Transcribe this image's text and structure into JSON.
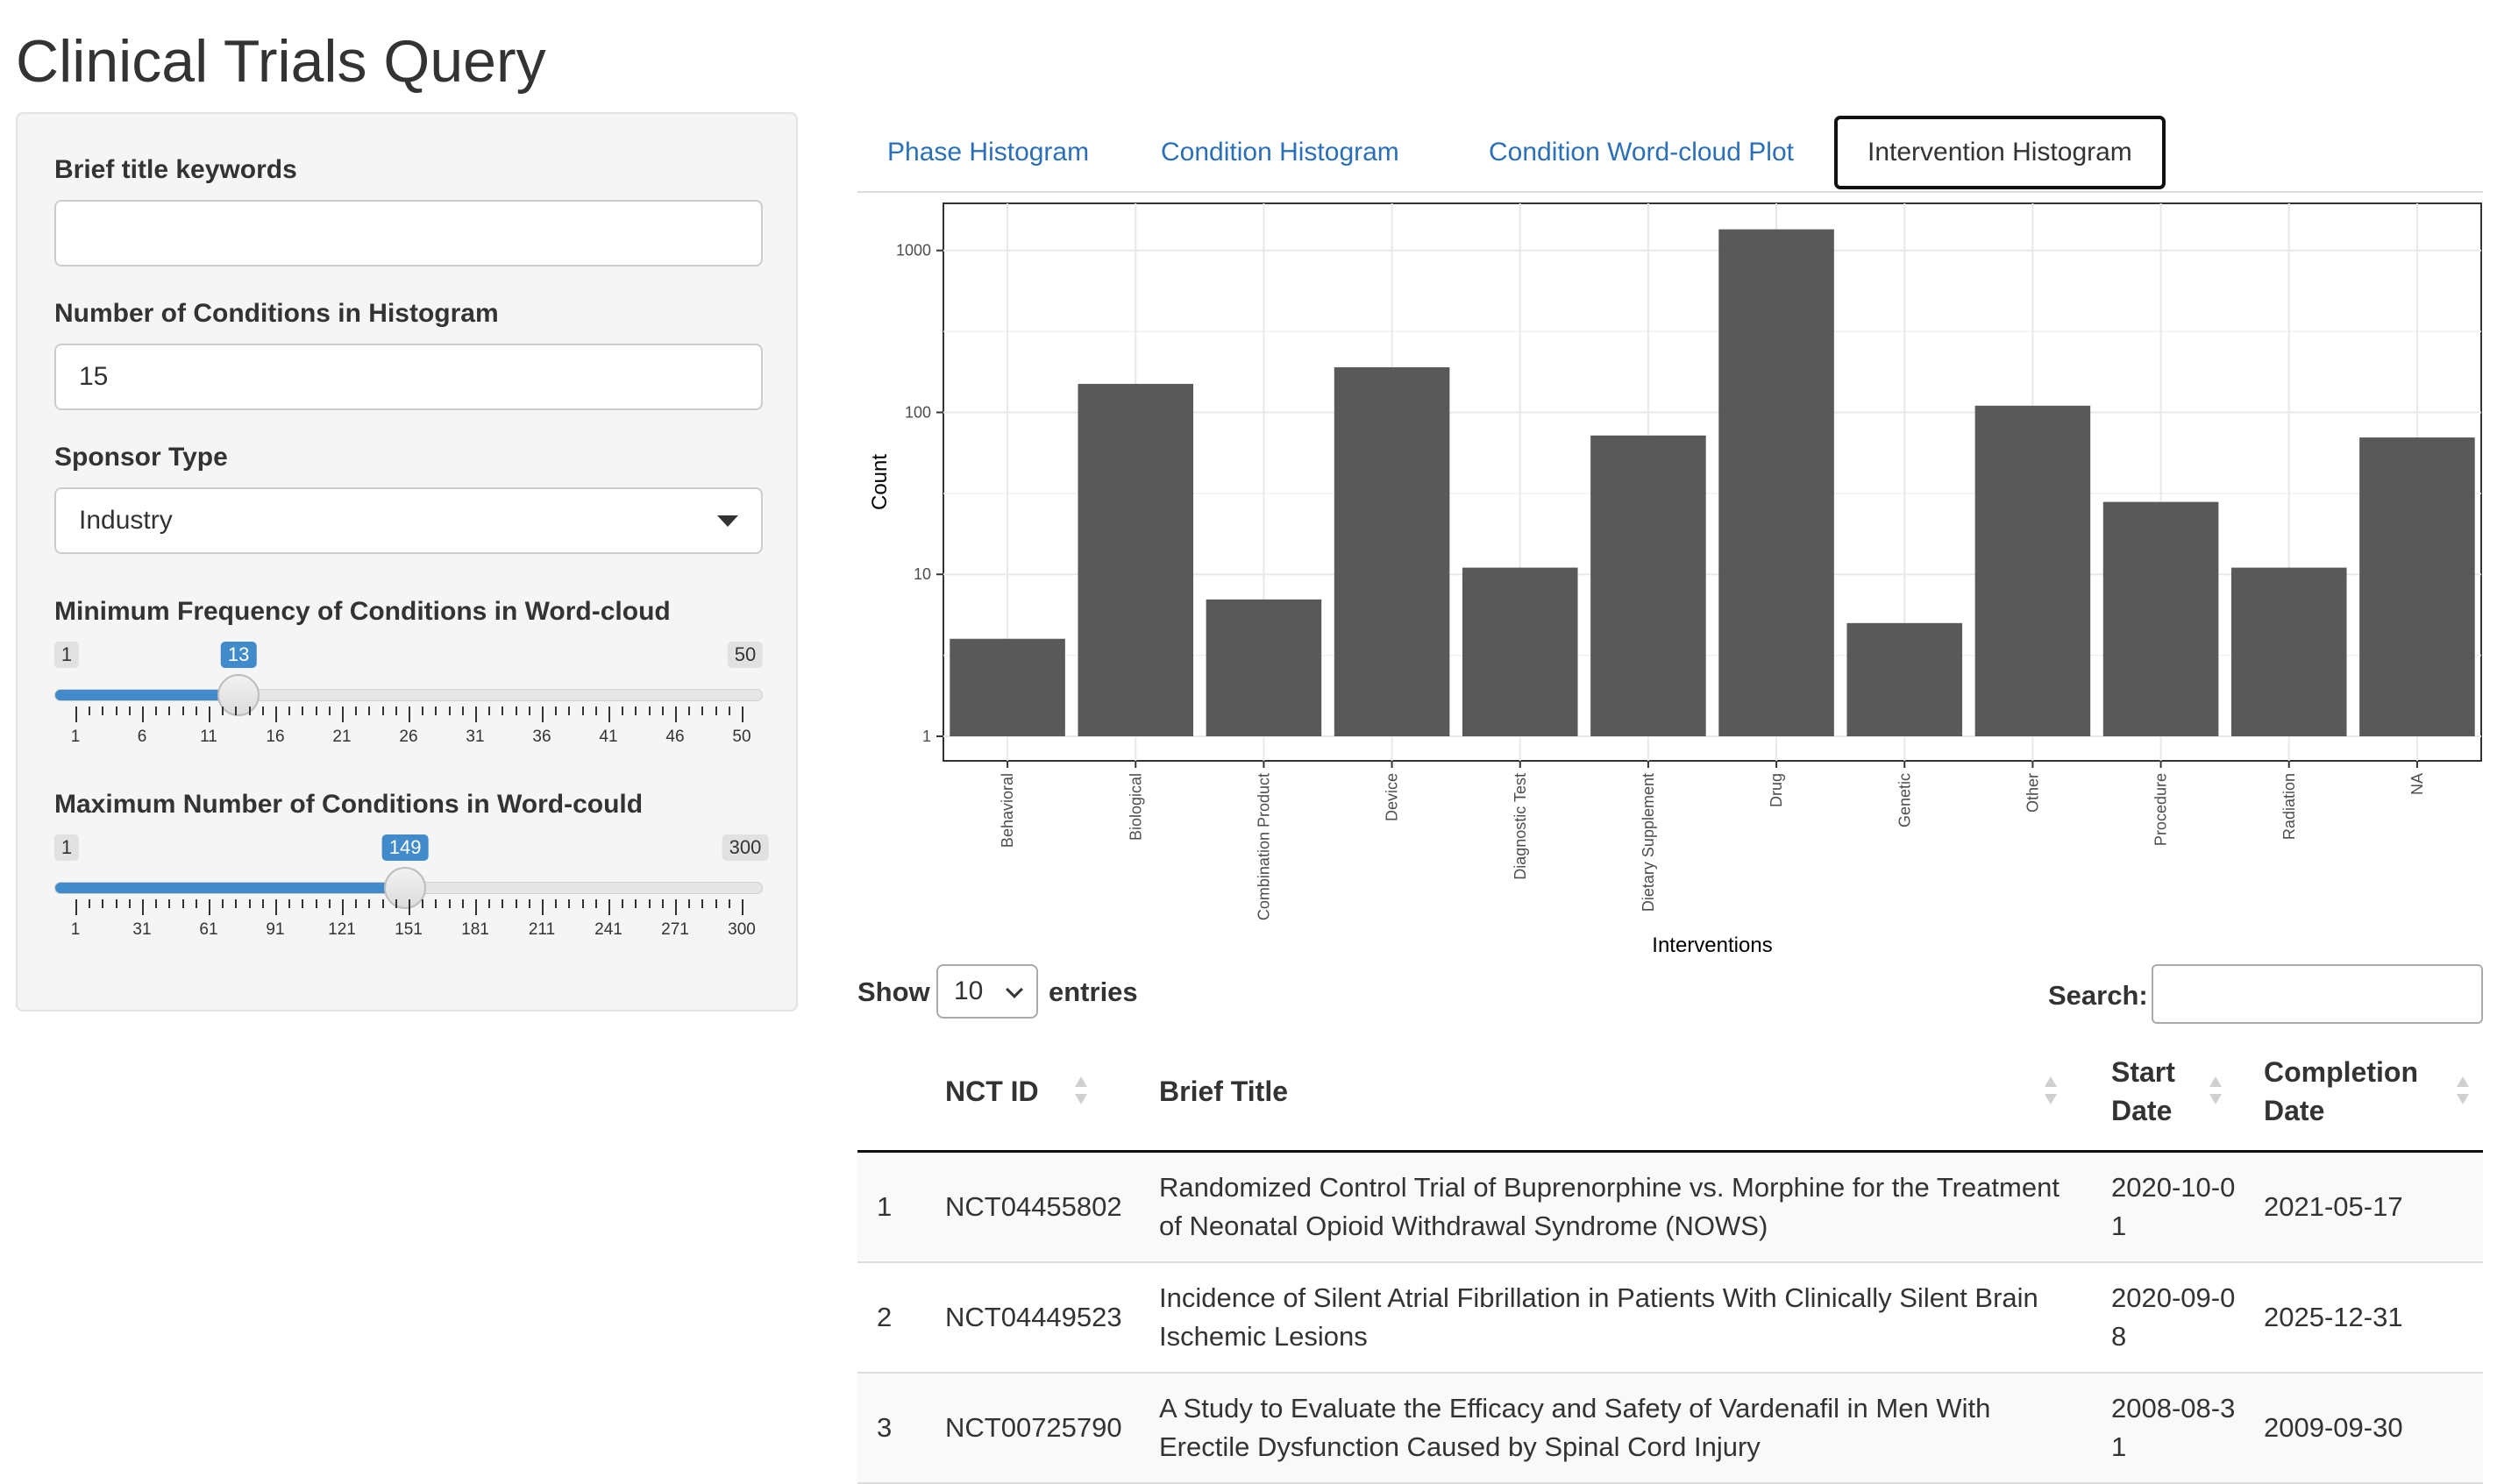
{
  "app": {
    "title": "Clinical Trials Query"
  },
  "sidebar": {
    "title_keywords": {
      "label": "Brief title keywords",
      "value": ""
    },
    "num_conditions": {
      "label": "Number of Conditions in Histogram",
      "value": "15"
    },
    "sponsor_type": {
      "label": "Sponsor Type",
      "selected": "Industry"
    },
    "min_freq": {
      "label": "Minimum Frequency of Conditions in Word-cloud",
      "min": 1,
      "max": 50,
      "value": 13,
      "min_label": "1",
      "max_label": "50",
      "value_label": "13",
      "ticks": [
        "1",
        "6",
        "11",
        "16",
        "21",
        "26",
        "31",
        "36",
        "41",
        "46",
        "50"
      ]
    },
    "max_conditions": {
      "label": "Maximum Number of Conditions in Word-could",
      "min": 1,
      "max": 300,
      "value": 149,
      "min_label": "1",
      "max_label": "300",
      "value_label": "149",
      "ticks": [
        "1",
        "31",
        "61",
        "91",
        "121",
        "151",
        "181",
        "211",
        "241",
        "271",
        "300"
      ]
    }
  },
  "tabs": [
    {
      "label": "Phase Histogram",
      "active": false
    },
    {
      "label": "Condition Histogram",
      "active": false
    },
    {
      "label": "Condition Word-cloud Plot",
      "active": false
    },
    {
      "label": "Intervention Histogram",
      "active": true
    }
  ],
  "chart_data": {
    "type": "bar",
    "categories": [
      "Behavioral",
      "Biological",
      "Combination Product",
      "Device",
      "Diagnostic Test",
      "Dietary Supplement",
      "Drug",
      "Genetic",
      "Other",
      "Procedure",
      "Radiation",
      "NA"
    ],
    "values": [
      4,
      150,
      7,
      190,
      11,
      72,
      1350,
      5,
      110,
      28,
      11,
      70
    ],
    "xlabel": "Interventions",
    "ylabel": "Count",
    "y_scale": "log10",
    "ylim": [
      1,
      1600
    ],
    "y_ticks": [
      "1",
      "10",
      "100",
      "1000"
    ],
    "grid": true,
    "bar_color": "#595959"
  },
  "table_controls": {
    "show_label": "Show",
    "entries_label": "entries",
    "page_length": "10",
    "search_label": "Search:",
    "search_value": ""
  },
  "table": {
    "columns": [
      "",
      "NCT ID",
      "Brief Title",
      "Start Date",
      "Completion Date"
    ],
    "rows": [
      [
        "1",
        "NCT04455802",
        "Randomized Control Trial of Buprenorphine vs. Morphine for the Treatment of Neonatal Opioid Withdrawal Syndrome (NOWS)",
        "2020-10-01",
        "2021-05-17"
      ],
      [
        "2",
        "NCT04449523",
        "Incidence of Silent Atrial Fibrillation in Patients With Clinically Silent Brain Ischemic Lesions",
        "2020-09-08",
        "2025-12-31"
      ],
      [
        "3",
        "NCT00725790",
        "A Study to Evaluate the Efficacy and Safety of Vardenafil in Men With Erectile Dysfunction Caused by Spinal Cord Injury",
        "2008-08-31",
        "2009-09-30"
      ]
    ]
  }
}
